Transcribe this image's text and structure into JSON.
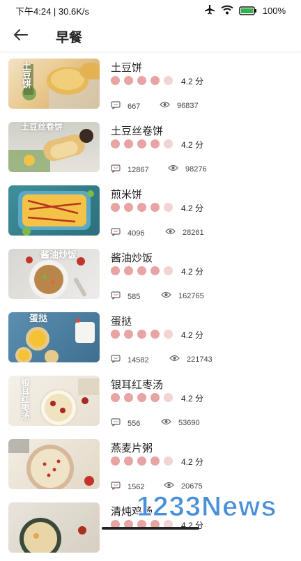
{
  "status": {
    "time_speed": "下午4:24 | 30.6K/s",
    "battery": "100%",
    "icons": [
      "airplane-icon",
      "wifi-icon",
      "battery-icon"
    ]
  },
  "header": {
    "title": "早餐",
    "back_icon": "arrow-left-icon"
  },
  "items": [
    {
      "title": "土豆饼",
      "score": "4.2 分",
      "comments": "667",
      "views": "96837",
      "thumb_label": "土豆饼",
      "rating_fraction": 0.84
    },
    {
      "title": "土豆丝卷饼",
      "score": "4.2 分",
      "comments": "12867",
      "views": "98276",
      "thumb_label": "土豆丝卷饼",
      "rating_fraction": 0.84
    },
    {
      "title": "煎米饼",
      "score": "4.2 分",
      "comments": "4096",
      "views": "28261",
      "thumb_label": "",
      "rating_fraction": 0.84
    },
    {
      "title": "酱油炒饭",
      "score": "4.2 分",
      "comments": "585",
      "views": "162765",
      "thumb_label": "酱油炒饭",
      "rating_fraction": 0.84
    },
    {
      "title": "蛋挞",
      "score": "4.2 分",
      "comments": "14582",
      "views": "221743",
      "thumb_label": "蛋挞",
      "rating_fraction": 0.84
    },
    {
      "title": "银耳红枣汤",
      "score": "4.2 分",
      "comments": "556",
      "views": "53690",
      "thumb_label": "银耳红枣汤",
      "rating_fraction": 0.84
    },
    {
      "title": "燕麦片粥",
      "score": "4.2 分",
      "comments": "1562",
      "views": "20675",
      "thumb_label": "",
      "rating_fraction": 0.84
    },
    {
      "title": "清炖鸡汤",
      "score": "4.2 分",
      "comments": "",
      "views": "",
      "thumb_label": "",
      "rating_fraction": 0.84
    }
  ],
  "watermark": "1233News",
  "colors": {
    "star_active": "#e8a3a3",
    "star_inactive": "#f4d3d3",
    "accent": "#4a90d9"
  }
}
